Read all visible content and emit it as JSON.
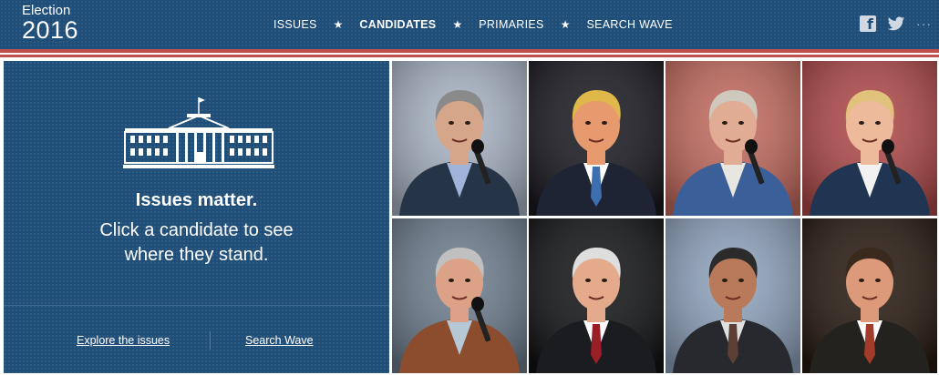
{
  "header": {
    "logo_line1": "Election",
    "logo_line2": "2016",
    "nav": [
      "ISSUES",
      "CANDIDATES",
      "PRIMARIES",
      "SEARCH WAVE"
    ],
    "active_nav": "CANDIDATES",
    "social_icons": [
      "facebook-icon",
      "twitter-icon",
      "more-icon"
    ],
    "more_glyph": "···"
  },
  "panel": {
    "icon": "white-house-icon",
    "headline": "Issues matter.",
    "subline1": "Click a candidate to see",
    "subline2": "where they stand.",
    "link_explore": "Explore the issues",
    "link_search": "Search Wave"
  },
  "colors": {
    "brand_blue": "#1f4e79",
    "accent_red": "#c0504d",
    "text": "#ffffff"
  },
  "candidates": [
    {
      "bg": "#a9b4c4",
      "suit": "#253446",
      "shirt": "#9fb4d8",
      "hair": "#8a8a8a",
      "skin": "#d6a68a",
      "mic": true
    },
    {
      "bg": "#17171f",
      "suit": "#1e2433",
      "shirt": "#ffffff",
      "hair": "#e0b84a",
      "skin": "#e79a6e",
      "tie": "#3d6fb0"
    },
    {
      "bg": "#c46a5e",
      "suit": "#3b5f99",
      "shirt": "#e8e6e0",
      "hair": "#cfc8bc",
      "skin": "#e0ac93",
      "mic": true
    },
    {
      "bg": "#b04848",
      "suit": "#1f3552",
      "shirt": "#f2f2f2",
      "hair": "#e0c27a",
      "skin": "#edbb9c",
      "mic": true
    },
    {
      "bg": "#6d7d8e",
      "suit": "#8b4d2e",
      "shirt": "#b6c8d6",
      "hair": "#c0c0c0",
      "skin": "#dca287",
      "mic": true
    },
    {
      "bg": "#111214",
      "suit": "#1b1c20",
      "shirt": "#ffffff",
      "hair": "#dedede",
      "skin": "#e3ab8c",
      "tie": "#9a1e25"
    },
    {
      "bg": "#8fa3bd",
      "suit": "#27292e",
      "shirt": "#e0e0e0",
      "hair": "#2b2b2b",
      "skin": "#b87a5a",
      "tie": "#5d4035"
    },
    {
      "bg": "#26180f",
      "suit": "#23221f",
      "shirt": "#ffffff",
      "hair": "#3a2a1e",
      "skin": "#dc9a7a",
      "tie": "#a23b2a"
    }
  ]
}
